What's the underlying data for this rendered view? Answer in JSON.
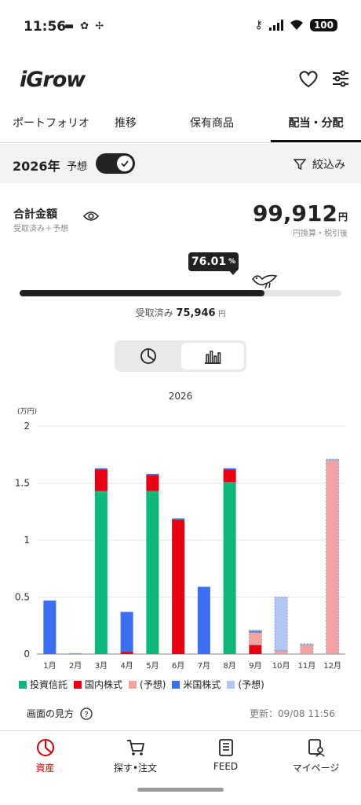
{
  "status": {
    "time": "11:56",
    "battery": "100"
  },
  "app": {
    "logo": "iGrow"
  },
  "tabs": [
    {
      "label": "ポートフォリオ"
    },
    {
      "label": "推移"
    },
    {
      "label": "保有商品"
    },
    {
      "label": "配当・分配"
    }
  ],
  "filter": {
    "year": "2026年",
    "forecast_label": "予想",
    "forecast_on": true,
    "filter_label": "絞込み"
  },
  "summary": {
    "title": "合計金額",
    "subtitle": "受取済み＋予想",
    "total": "99,912",
    "unit": "円",
    "note": "円換算・税引後",
    "progress_percent": "76.01",
    "progress_symbol": "%",
    "received_label": "受取済み",
    "received_value": "75,946",
    "received_unit": "円"
  },
  "chart_data": {
    "type": "bar",
    "title": "2026",
    "ylabel": "(万円)",
    "ylim": [
      0,
      2
    ],
    "yticks": [
      "0",
      "0.5",
      "1",
      "1.5",
      "2"
    ],
    "categories": [
      "1月",
      "2月",
      "3月",
      "4月",
      "5月",
      "6月",
      "7月",
      "8月",
      "9月",
      "10月",
      "11月",
      "12月"
    ],
    "series": [
      {
        "name": "投資信託",
        "color": "#0fb77a",
        "values": [
          0,
          0,
          1.43,
          0,
          1.43,
          0,
          0,
          1.51,
          0,
          0,
          0,
          0
        ]
      },
      {
        "name": "国内株式",
        "color": "#e60012",
        "values": [
          0,
          0,
          0.19,
          0.02,
          0.14,
          1.18,
          0,
          0.11,
          0.08,
          0,
          0,
          0
        ]
      },
      {
        "name": "(予想)",
        "color": "#f4a3a3",
        "values": [
          0,
          0,
          0,
          0,
          0,
          0,
          0,
          0,
          0.11,
          0.03,
          0.08,
          1.7
        ]
      },
      {
        "name": "米国株式",
        "color": "#3b6ff0",
        "values": [
          0.47,
          0.005,
          0.01,
          0.35,
          0.01,
          0.01,
          0.59,
          0.01,
          0.01,
          0,
          0,
          0
        ]
      },
      {
        "name": "(予想)",
        "color": "#b3c4f7",
        "values": [
          0,
          0,
          0,
          0,
          0,
          0,
          0,
          0,
          0.01,
          0.47,
          0.01,
          0.01
        ]
      }
    ]
  },
  "footer": {
    "howto": "画面の見方",
    "updated": "更新：09/08 11:56"
  },
  "nav": [
    {
      "label": "資産"
    },
    {
      "label": "探す•注文"
    },
    {
      "label": "FEED"
    },
    {
      "label": "マイページ"
    }
  ]
}
